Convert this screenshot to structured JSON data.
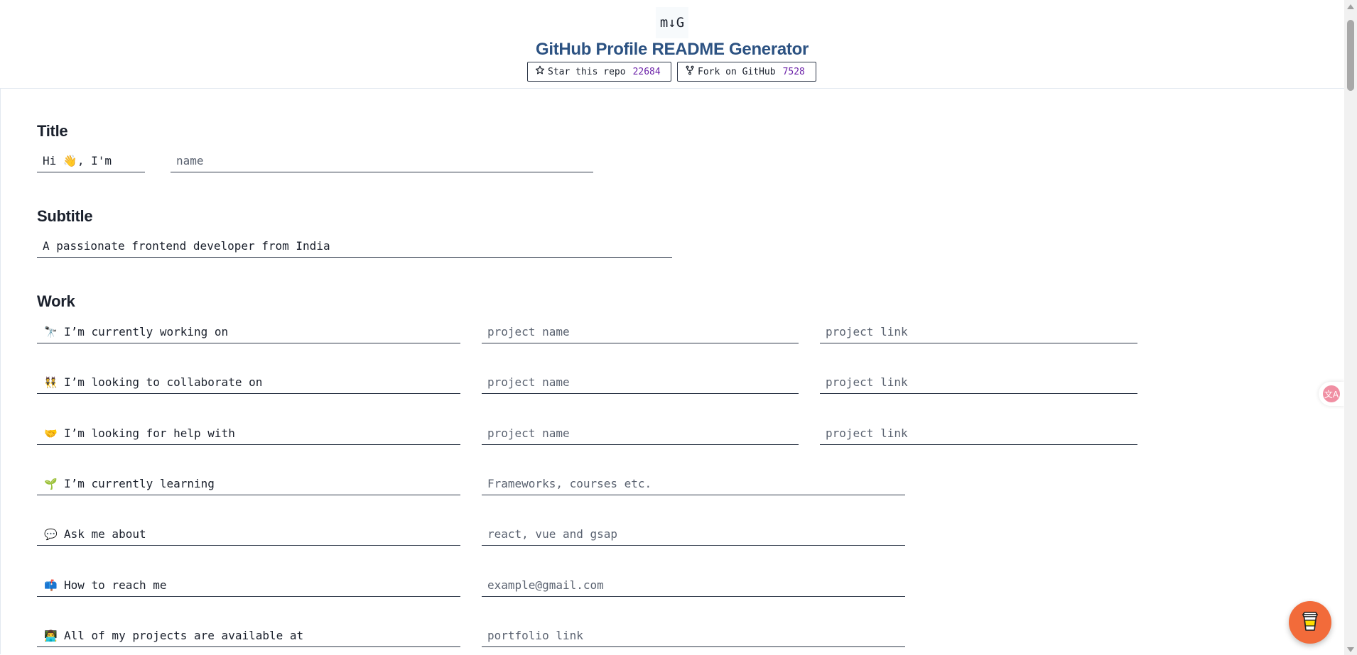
{
  "header": {
    "logo_text": "m↓G",
    "title": "GitHub Profile README Generator",
    "star_label": "Star this repo",
    "star_count": "22684",
    "fork_label": "Fork on GitHub",
    "fork_count": "7528"
  },
  "title_section": {
    "heading": "Title",
    "prefix_value": "Hi 👋, I'm",
    "name_placeholder": "name"
  },
  "subtitle_section": {
    "heading": "Subtitle",
    "value": "A passionate frontend developer from India"
  },
  "work_section": {
    "heading": "Work",
    "rows": [
      {
        "emoji": "🔭",
        "label": "I’m currently working on",
        "placeholder1": "project name",
        "placeholder2": "project link"
      },
      {
        "emoji": "👯",
        "label": "I’m looking to collaborate on",
        "placeholder1": "project name",
        "placeholder2": "project link"
      },
      {
        "emoji": "🤝",
        "label": "I’m looking for help with",
        "placeholder1": "project name",
        "placeholder2": "project link"
      },
      {
        "emoji": "🌱",
        "label": "I’m currently learning",
        "placeholder1": "Frameworks, courses etc."
      },
      {
        "emoji": "💬",
        "label": "Ask me about",
        "placeholder1": "react, vue and gsap"
      },
      {
        "emoji": "📫",
        "label": "How to reach me",
        "placeholder1": "example@gmail.com"
      },
      {
        "emoji": "👨‍💻",
        "label": "All of my projects are available at",
        "placeholder1": "portfolio link"
      }
    ]
  },
  "colors": {
    "title_blue": "#2c5282",
    "count_purple": "#6b21a8",
    "coffee_orange": "#f26b3a"
  },
  "icons": {
    "star": "star-icon",
    "fork": "fork-icon",
    "translate": "translate-icon",
    "coffee": "coffee-cup-icon"
  }
}
